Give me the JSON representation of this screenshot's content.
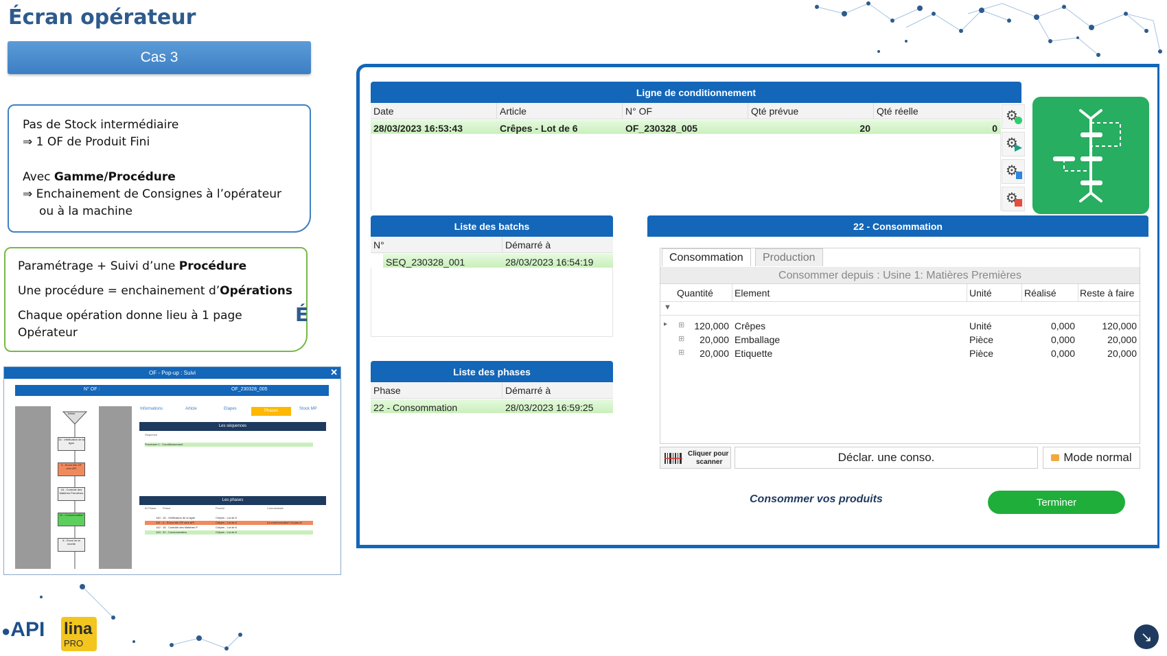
{
  "slide": {
    "title": "Écran opérateur",
    "case_label": "Cas 3",
    "box1": {
      "line1": "Pas de Stock intermédiaire",
      "line2": "⇒ 1 OF de Produit Fini",
      "line3_pre": "Avec ",
      "line3_bold": "Gamme/Procédure",
      "line4": "⇒ Enchainement de Consignes à l’opérateur",
      "line5": "ou à la machine"
    },
    "box2": {
      "line1_pre": "Paramétrage + Suivi d’une ",
      "line1_bold": "Procédure",
      "line2_pre": "Une procédure = enchainement d’",
      "line2_bold": "Opérations",
      "line3": "Chaque opération donne lieu à 1 page",
      "line4": "Opérateur"
    },
    "side_letter": "É"
  },
  "mini_popup": {
    "title": "OF - Pop-up : Suivi",
    "of_label": "N° OF :",
    "of_value": "OF_230328_005",
    "tabs": [
      "Informations",
      "Article",
      "Etapes",
      "Stock MP"
    ],
    "active_tab": "Phases",
    "seq_title": "Les séquences",
    "seq_col": "Séquence",
    "seq_row": "Procédure 1 : Conditionnement",
    "phases_title": "Les phases",
    "phase_cols": [
      "ID Phase",
      "Phase",
      "Produit",
      "Commentaire"
    ],
    "phase_rows": [
      {
        "phase": "140 : 15 - Vérification de la ligne",
        "product": "Crêpes - Lot de 6",
        "comment": ""
      },
      {
        "phase": "141 : 3 - Envoi info OF vers API",
        "product": "Crêpes - Lot de 6",
        "comment": "La communication n'a pas ét"
      },
      {
        "phase": "142 : 16 - Contrôle des Matières P",
        "product": "Crêpes - Lot de 6",
        "comment": ""
      },
      {
        "phase": "143 : 22 - Consommation",
        "product": "Crêpes - Lot de 6",
        "comment": ""
      }
    ],
    "flow": [
      "Début",
      "15 - Vérification de la ligne",
      "3 - Envoi info OF vers API",
      "16 - Contrôle des Matières Premières",
      "22 - Consommation",
      "8 - Envoi de la recette"
    ]
  },
  "ligne": {
    "title": "Ligne de conditionnement",
    "columns": [
      "Date",
      "Article",
      "N° OF",
      "Qté prévue",
      "Qté réelle"
    ],
    "row": {
      "date": "28/03/2023 16:53:43",
      "article": "Crêpes - Lot de 6",
      "of": "OF_230328_005",
      "qte_prevue": "20",
      "qte_reelle": "0"
    }
  },
  "batchs": {
    "title": "Liste des batchs",
    "columns": [
      "N°",
      "Démarré à"
    ],
    "row": {
      "num": "SEQ_230328_001",
      "start": "28/03/2023 16:54:19"
    }
  },
  "phases": {
    "title": "Liste des phases",
    "columns": [
      "Phase",
      "Démarré à"
    ],
    "row": {
      "phase": "22 - Consommation",
      "start": "28/03/2023 16:59:25"
    }
  },
  "conso": {
    "title": "22 - Consommation",
    "tab_active": "Consommation",
    "tab_inactive": "Production",
    "from": "Consommer depuis : Usine 1: Matières Premières",
    "columns": [
      "Quantité",
      "Element",
      "Unité",
      "Réalisé",
      "Reste à faire"
    ],
    "rows": [
      {
        "qty": "120,000",
        "element": "Crêpes",
        "unit": "Unité",
        "done": "0,000",
        "rest": "120,000"
      },
      {
        "qty": "20,000",
        "element": "Emballage",
        "unit": "Pièce",
        "done": "0,000",
        "rest": "20,000"
      },
      {
        "qty": "20,000",
        "element": "Etiquette",
        "unit": "Pièce",
        "done": "0,000",
        "rest": "20,000"
      }
    ],
    "scan_label_1": "Cliquer pour",
    "scan_label_2": "scanner",
    "declare_label": "Déclar. une conso.",
    "mode_label": "Mode normal",
    "cta_text": "Consommer vos produits",
    "finish_label": "Terminer"
  },
  "logos": {
    "api": "API",
    "lina": "lina",
    "lina_sub": "PRO"
  },
  "colors": {
    "primary": "#1366b8",
    "green": "#27ae60",
    "finish": "#1fae3a",
    "row_green": "#c9f0bb"
  }
}
